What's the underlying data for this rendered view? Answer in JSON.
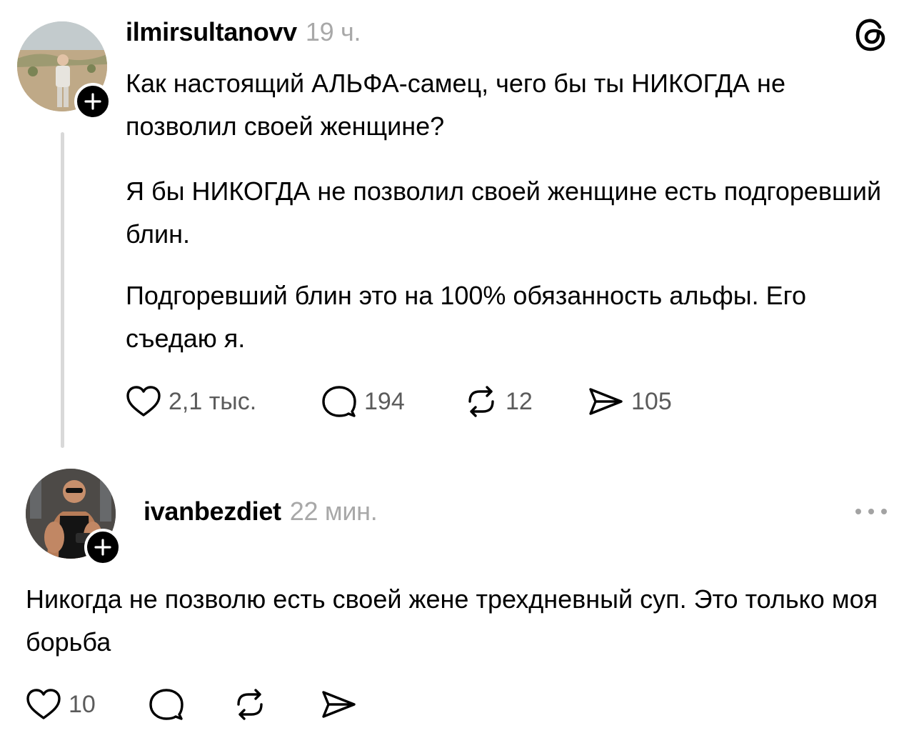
{
  "post": {
    "username": "ilmirsultanovv",
    "time": "19 ч.",
    "paragraphs": [
      "Как настоящий АЛЬФА-самец, чего бы ты НИКОГДА не позволил своей женщине?",
      "Я бы НИКОГДА не позволил своей женщине есть подгоревший блин.",
      "Подгоревший блин это на 100% обязанность альфы. Его съедаю я."
    ],
    "likes": "2,1 тыс.",
    "replies": "194",
    "reposts": "12",
    "shares": "105"
  },
  "reply": {
    "username": "ivanbezdiet",
    "time": "22 мин.",
    "text": "Никогда не позволю есть своей жене трехдневный суп. Это только моя борьба",
    "likes": "10"
  },
  "icons": {
    "app_logo": "threads-logo-icon",
    "follow": "plus-icon",
    "like": "heart-icon",
    "reply": "comment-bubble-icon",
    "repost": "repost-icon",
    "share": "send-icon",
    "menu": "more-dots-icon"
  },
  "colors": {
    "text": "#000000",
    "secondary_text": "#a8a8a8",
    "action_gray": "#5b5b5b",
    "thread_line": "#d9d9d9"
  }
}
